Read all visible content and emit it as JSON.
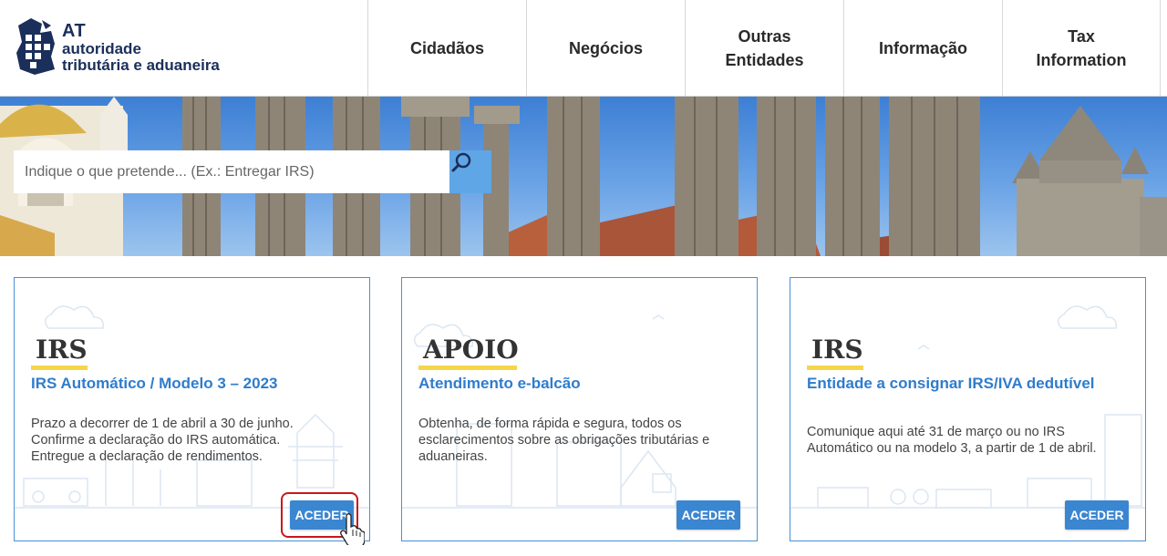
{
  "brand": {
    "abbr": "AT",
    "line1": "autoridade",
    "line2": "tributária e aduaneira"
  },
  "nav": {
    "items": [
      {
        "label": "Cidadãos"
      },
      {
        "label": "Negócios"
      },
      {
        "label": "Outras Entidades"
      },
      {
        "label": "Informação"
      },
      {
        "label": "Tax Information"
      }
    ]
  },
  "search": {
    "placeholder": "Indique o que pretende... (Ex.: Entregar IRS)",
    "icon": "search-icon"
  },
  "cards": [
    {
      "tag": "IRS",
      "title": "IRS Automático / Modelo 3 – 2023",
      "description": "Prazo a decorrer de 1 de abril a 30 de junho. Confirme a declaração do IRS automática. Entregue a declaração de rendimentos.",
      "button": "ACEDER"
    },
    {
      "tag": "APOIO",
      "title": "Atendimento e-balcão",
      "description": "Obtenha, de forma rápida e segura, todos os esclarecimentos sobre as obrigações tributárias e aduaneiras.",
      "button": "ACEDER"
    },
    {
      "tag": "IRS",
      "title": "Entidade a consignar IRS/IVA dedutível",
      "description": "Comunique aqui até 31 de março ou no IRS Automático ou na modelo 3, a partir de 1 de abril.",
      "button": "ACEDER"
    }
  ],
  "colors": {
    "accent": "#3b86d1",
    "title": "#2f7ccc",
    "tag_underline": "#f5d64a",
    "highlight": "#c8171d"
  }
}
